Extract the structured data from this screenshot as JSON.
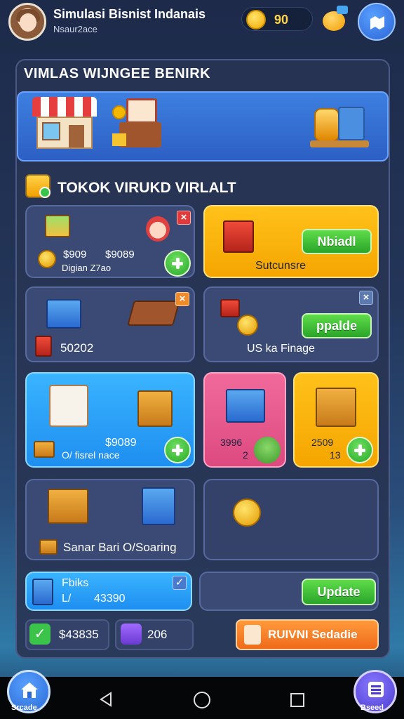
{
  "header": {
    "title": "Simulasi Bisnist Indanais",
    "subtitle": "Nsaur2ace",
    "coins": "90"
  },
  "panel": {
    "title": "VIMLAS WIJNGEE BENIRK"
  },
  "section": {
    "title": "TOKOK VIRUKD VIRLALT"
  },
  "cards": {
    "c1": {
      "price_a": "$909",
      "price_b": "$9089",
      "sub": "Digian Z7ao"
    },
    "c2": {
      "button": "Nbiadl",
      "label": "Sutcunsre"
    },
    "c3": {
      "value": "50202"
    },
    "c4": {
      "button": "ppalde",
      "label": "US ka Finage"
    },
    "c5": {
      "price": "$9089",
      "label": "O/ fisrel nace"
    },
    "c6": {
      "value": "3996",
      "sub": "2"
    },
    "c7": {
      "value": "2509",
      "sub": "13"
    },
    "c8": {
      "label": "Sanar Bari O/Soaring"
    }
  },
  "fund_card": {
    "title": "Fbiks",
    "prefix": "L/",
    "amount": "43390"
  },
  "update_button": "Update",
  "stats": {
    "money": "$43835",
    "gems": "206"
  },
  "orange_button": "RUIVNI Sedadie",
  "nav": {
    "home_label": "Srcade",
    "menu_label": "Bseed"
  },
  "colors": {
    "accent_green": "#2aa52a",
    "accent_yellow": "#f5a500",
    "accent_blue": "#1e8ef0",
    "accent_pink": "#dd4a80",
    "accent_orange": "#f08a2a"
  }
}
